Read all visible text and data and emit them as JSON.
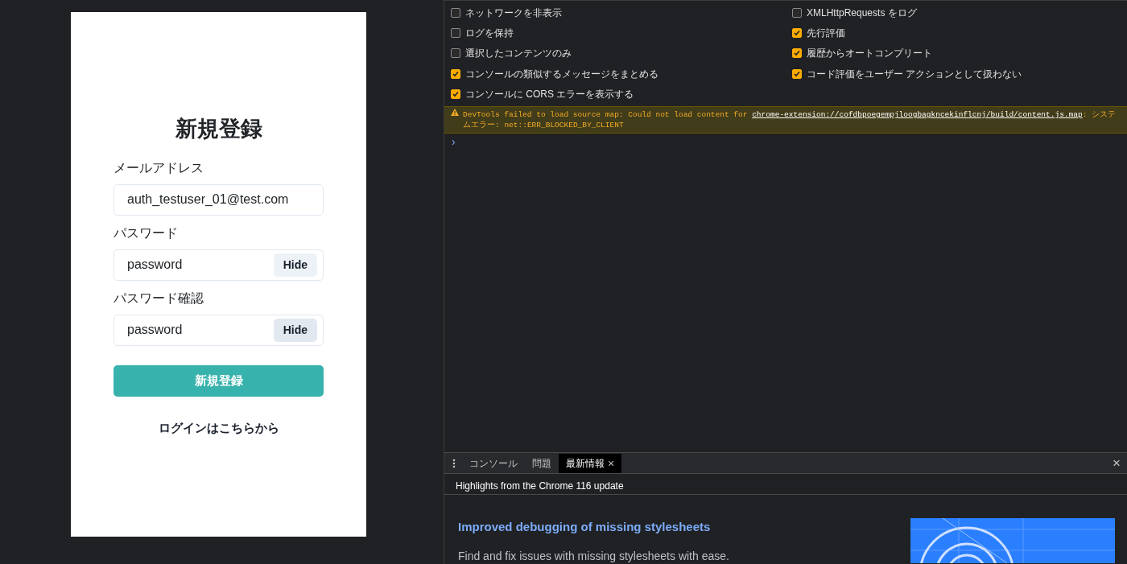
{
  "app": {
    "title": "新規登録",
    "fields": [
      {
        "label": "メールアドレス",
        "value": "auth_testuser_01@test.com"
      },
      {
        "label": "パスワード",
        "value": "password",
        "toggle": "Hide"
      },
      {
        "label": "パスワード確認",
        "value": "password",
        "toggle": "Hide"
      }
    ],
    "submit": "新規登録",
    "login_link": "ログインはこちらから"
  },
  "devtools": {
    "settings": [
      {
        "label": "ネットワークを非表示",
        "checked": false
      },
      {
        "label": "XMLHttpRequests をログ",
        "checked": false
      },
      {
        "label": "ログを保持",
        "checked": false
      },
      {
        "label": "先行評価",
        "checked": true
      },
      {
        "label": "選択したコンテンツのみ",
        "checked": false
      },
      {
        "label": "履歴からオートコンプリート",
        "checked": true
      },
      {
        "label": "コンソールの類似するメッセージをまとめる",
        "checked": true
      },
      {
        "label": "コード評価をユーザー アクションとして扱わない",
        "checked": true
      },
      {
        "label": "コンソールに CORS エラーを表示する",
        "checked": true
      }
    ],
    "warning": {
      "text": "DevTools failed to load source map: Could not load content for ",
      "link": "chrome-extension://cofdbpoegempjloogbagkncekinflcnj/build/content.js.map",
      "suffix": ": システムエラー: net::ERR_BLOCKED_BY_CLIENT"
    },
    "prompt": "›",
    "drawer_tabs": [
      {
        "label": "コンソール",
        "selected": false
      },
      {
        "label": "問題",
        "selected": false
      },
      {
        "label": "最新情報",
        "selected": true,
        "closable": true
      }
    ],
    "close": "×",
    "highlights": "Highlights from the Chrome 116 update",
    "article": {
      "heading": "Improved debugging of missing stylesheets",
      "body": "Find and fix issues with missing stylesheets with ease."
    }
  }
}
